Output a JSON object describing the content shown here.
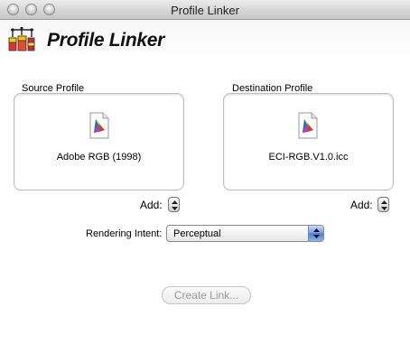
{
  "window": {
    "title": "Profile Linker"
  },
  "header": {
    "app_name": "Profile Linker",
    "icon": "profile-linker-app-icon"
  },
  "source": {
    "label": "Source Profile",
    "profile_name": "Adobe RGB (1998)",
    "icon": "icc-profile-document-icon"
  },
  "destination": {
    "label": "Destination Profile",
    "profile_name": "ECI-RGB.V1.0.icc",
    "icon": "icc-profile-document-icon"
  },
  "add_label": "Add:",
  "rendering": {
    "label": "Rendering Intent:",
    "value": "Perceptual"
  },
  "create_button": {
    "label": "Create Link...",
    "enabled": false
  },
  "colors": {
    "select_accent": "#4a7bd0",
    "disabled_text": "#9a9a9a"
  }
}
